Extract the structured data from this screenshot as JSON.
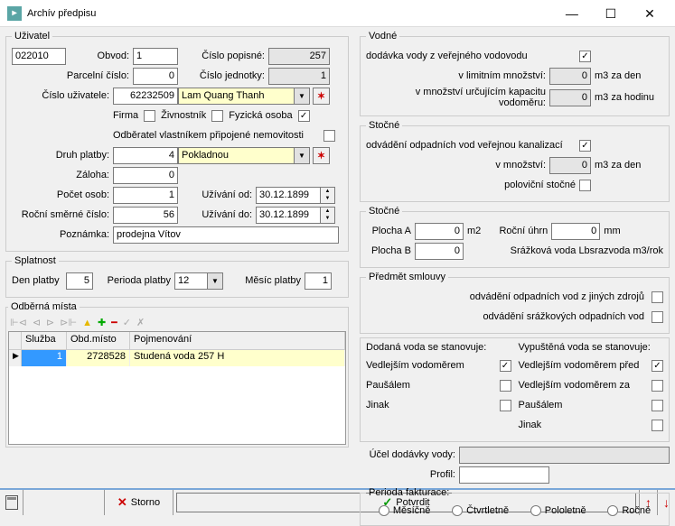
{
  "window": {
    "title": "Archív předpisu"
  },
  "user": {
    "legend": "Uživatel",
    "code": "022010",
    "obvod_lbl": "Obvod:",
    "obvod": "1",
    "cp_lbl": "Číslo popisné:",
    "cp": "257",
    "parc_lbl": "Parcelní číslo:",
    "parc": "0",
    "cj_lbl": "Číslo jednotky:",
    "cj": "1",
    "cu_lbl": "Číslo uživatele:",
    "cu": "62232509",
    "cu_name": "Lam Quang Thanh",
    "firma": "Firma",
    "zivnost": "Živnostník",
    "fyz": "Fyzická osoba",
    "odberatel": "Odběratel vlastníkem připojené nemovitosti",
    "druh_lbl": "Druh platby:",
    "druh": "4",
    "druh_name": "Pokladnou",
    "zaloha_lbl": "Záloha:",
    "zaloha": "0",
    "pocet_lbl": "Počet osob:",
    "pocet": "1",
    "uzod_lbl": "Užívání od:",
    "uzod": "30.12.1899",
    "smerne_lbl": "Roční směrné číslo:",
    "smerne": "56",
    "uzdo_lbl": "Užívání do:",
    "uzdo": "30.12.1899",
    "pozn_lbl": "Poznámka:",
    "pozn": "prodejna Vítov"
  },
  "splat": {
    "legend": "Splatnost",
    "den_lbl": "Den platby",
    "den": "5",
    "per_lbl": "Perioda platby",
    "per": "12",
    "mes_lbl": "Měsíc platby",
    "mes": "1"
  },
  "odber": {
    "legend": "Odběrná místa",
    "cols": {
      "sluzba": "Služba",
      "obd": "Obd.místo",
      "pojm": "Pojmenování"
    },
    "row": {
      "sluzba": "1",
      "obd": "2728528",
      "pojm": "Studená voda 257   H"
    }
  },
  "vodne": {
    "legend": "Vodné",
    "l1": "dodávka vody z veřejného vodovodu",
    "l2": "v limitním množství:",
    "v2": "0",
    "u2": "m3 za den",
    "l3": "v množství určujícím kapacitu vodoměru:",
    "v3": "0",
    "u3": "m3 za hodinu"
  },
  "stocne1": {
    "legend": "Stočné",
    "l1": "odvádění odpadních vod veřejnou kanalizací",
    "l2": "v množství:",
    "v2": "0",
    "u2": "m3 za den",
    "l3": "poloviční stočné"
  },
  "stocne2": {
    "legend": "Stočné",
    "pa_lbl": "Plocha A",
    "pa": "0",
    "pa_u": "m2",
    "ru_lbl": "Roční úhrn",
    "ru": "0",
    "ru_u": "mm",
    "pb_lbl": "Plocha B",
    "pb": "0",
    "sraz": "Srážková voda Lbsrazvoda   m3/rok"
  },
  "predmet": {
    "legend": "Předmět smlouvy",
    "l1": "odvádění odpadních vod z jiných zdrojů",
    "l2": "odvádění srážkových odpadních vod"
  },
  "stanov": {
    "dod": "Dodaná voda se stanovuje:",
    "vyp": "Vypuštěná voda se stanovuje:",
    "vedl": "Vedlejším vodoměrem",
    "paus": "Paušálem",
    "jinak": "Jinak",
    "vpred": "Vedlejším vodoměrem před",
    "vza": "Vedlejším vodoměrem za"
  },
  "ucel": {
    "lbl": "Účel dodávky vody:",
    "profil_lbl": "Profil:"
  },
  "fakt": {
    "legend": "Perioda fakturace:",
    "m": "Měsíčně",
    "c": "Čtvrtletně",
    "p": "Pololetně",
    "r": "Ročně"
  },
  "bottom": {
    "storno": "Storno",
    "potvrdit": "Potvrdit"
  }
}
